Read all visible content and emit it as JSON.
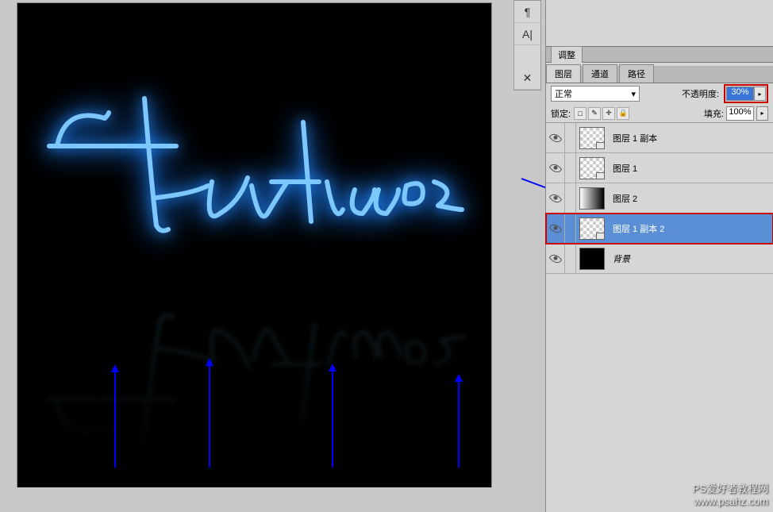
{
  "tabs": {
    "adjust": "调整",
    "layers": "图层",
    "channels": "通道",
    "paths": "路径"
  },
  "blend_mode": "正常",
  "opacity_label": "不透明度:",
  "opacity_value": "30%",
  "fill_label": "填充:",
  "fill_value": "100%",
  "lock_label": "锁定:",
  "lock_icons": {
    "trans": "□",
    "pixel": "✎",
    "move": "✛",
    "all": "🔒"
  },
  "layers": [
    {
      "name": "图层 1 副本",
      "thumb": "checker",
      "selected": false
    },
    {
      "name": "图层 1",
      "thumb": "checker",
      "selected": false
    },
    {
      "name": "图层 2",
      "thumb": "grad",
      "selected": false
    },
    {
      "name": "图层 1 副本 2",
      "thumb": "checker",
      "selected": true,
      "highlight": true
    },
    {
      "name": "背景",
      "thumb": "black",
      "selected": false,
      "bg": true
    }
  ],
  "tool_icons": {
    "paragraph": "¶",
    "text": "A|",
    "tools": "✕"
  },
  "watermark": {
    "line1": "PS爱好者教程网",
    "line2": "www.psahz.com"
  }
}
